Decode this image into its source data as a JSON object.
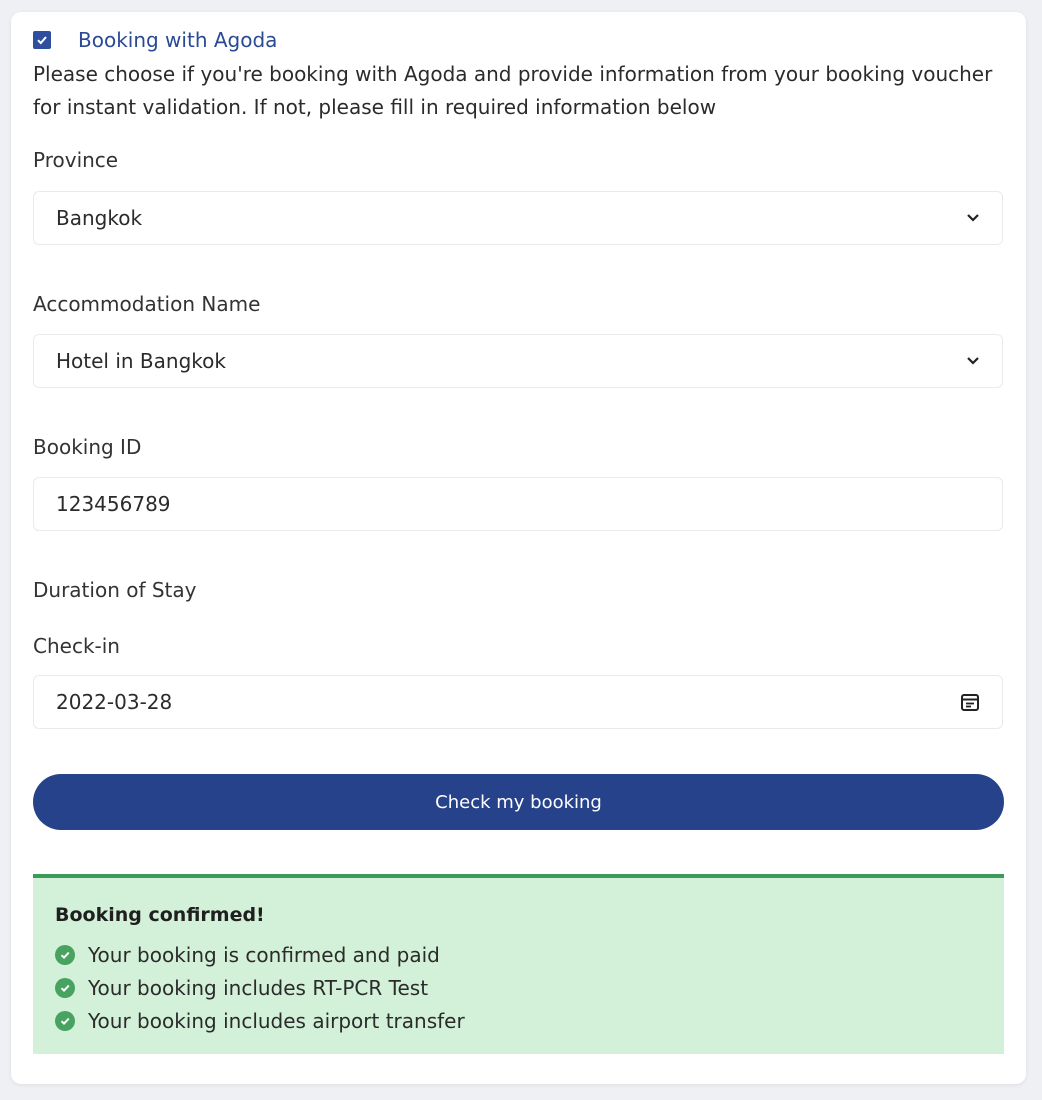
{
  "booking_option": {
    "label": "Booking with Agoda",
    "checked": true,
    "description": "Please choose if you're booking with Agoda and provide information from your booking voucher for instant validation. If not, please fill in required information below"
  },
  "province": {
    "label": "Province",
    "value": "Bangkok"
  },
  "accommodation": {
    "label": "Accommodation Name",
    "value": "Hotel in Bangkok"
  },
  "booking_id": {
    "label": "Booking ID",
    "value": "123456789"
  },
  "duration": {
    "label": "Duration of Stay",
    "checkin_label": "Check-in",
    "checkin_value": "2022-03-28"
  },
  "button": {
    "label": "Check my booking"
  },
  "alert": {
    "title": "Booking confirmed!",
    "items": [
      "Your booking is confirmed and paid",
      "Your booking includes RT-PCR Test",
      "Your booking includes airport transfer"
    ]
  },
  "icons": {
    "checkbox": "checkbox-checked-icon",
    "select": "chevron-down-icon",
    "calendar": "calendar-icon",
    "confirmed": "check-circle-icon"
  },
  "colors": {
    "accent": "#26428b",
    "success_bg": "#d2f1d8",
    "success_border": "#3c9a5c",
    "success_icon": "#48a361"
  }
}
